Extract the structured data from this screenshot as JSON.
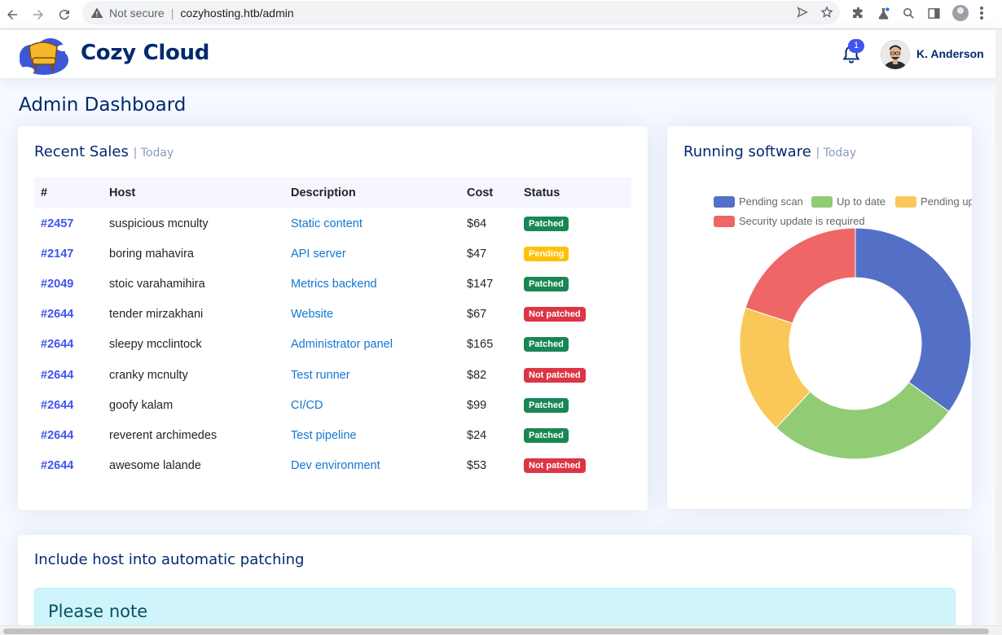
{
  "browser": {
    "security_label": "Not secure",
    "separator": "|",
    "url": "cozyhosting.htb/admin"
  },
  "header": {
    "brand": "Cozy Cloud",
    "notification_count": "1",
    "user_name": "K. Anderson"
  },
  "page": {
    "title": "Admin Dashboard"
  },
  "sales": {
    "title": "Recent Sales",
    "subtitle": "| Today",
    "columns": [
      "#",
      "Host",
      "Description",
      "Cost",
      "Status"
    ],
    "rows": [
      {
        "id": "#2457",
        "host": "suspicious mcnulty",
        "description": "Static content",
        "cost": "$64",
        "status": "Patched",
        "status_type": "success"
      },
      {
        "id": "#2147",
        "host": "boring mahavira",
        "description": "API server",
        "cost": "$47",
        "status": "Pending",
        "status_type": "warning"
      },
      {
        "id": "#2049",
        "host": "stoic varahamihira",
        "description": "Metrics backend",
        "cost": "$147",
        "status": "Patched",
        "status_type": "success"
      },
      {
        "id": "#2644",
        "host": "tender mirzakhani",
        "description": "Website",
        "cost": "$67",
        "status": "Not patched",
        "status_type": "danger"
      },
      {
        "id": "#2644",
        "host": "sleepy mcclintock",
        "description": "Administrator panel",
        "cost": "$165",
        "status": "Patched",
        "status_type": "success"
      },
      {
        "id": "#2644",
        "host": "cranky mcnulty",
        "description": "Test runner",
        "cost": "$82",
        "status": "Not patched",
        "status_type": "danger"
      },
      {
        "id": "#2644",
        "host": "goofy kalam",
        "description": "CI/CD",
        "cost": "$99",
        "status": "Patched",
        "status_type": "success"
      },
      {
        "id": "#2644",
        "host": "reverent archimedes",
        "description": "Test pipeline",
        "cost": "$24",
        "status": "Patched",
        "status_type": "success"
      },
      {
        "id": "#2644",
        "host": "awesome lalande",
        "description": "Dev environment",
        "cost": "$53",
        "status": "Not patched",
        "status_type": "danger"
      }
    ]
  },
  "software": {
    "title": "Running software",
    "subtitle": "| Today"
  },
  "chart_data": {
    "type": "pie",
    "categories": [
      "Pending scan",
      "Up to date",
      "Pending update",
      "Security update is required"
    ],
    "values": [
      35,
      27,
      18,
      20
    ],
    "colors": [
      "#5470c6",
      "#91cc75",
      "#fac858",
      "#ee6666"
    ],
    "legend_position": "top"
  },
  "patching": {
    "title": "Include host into automatic patching",
    "note_title": "Please note"
  }
}
